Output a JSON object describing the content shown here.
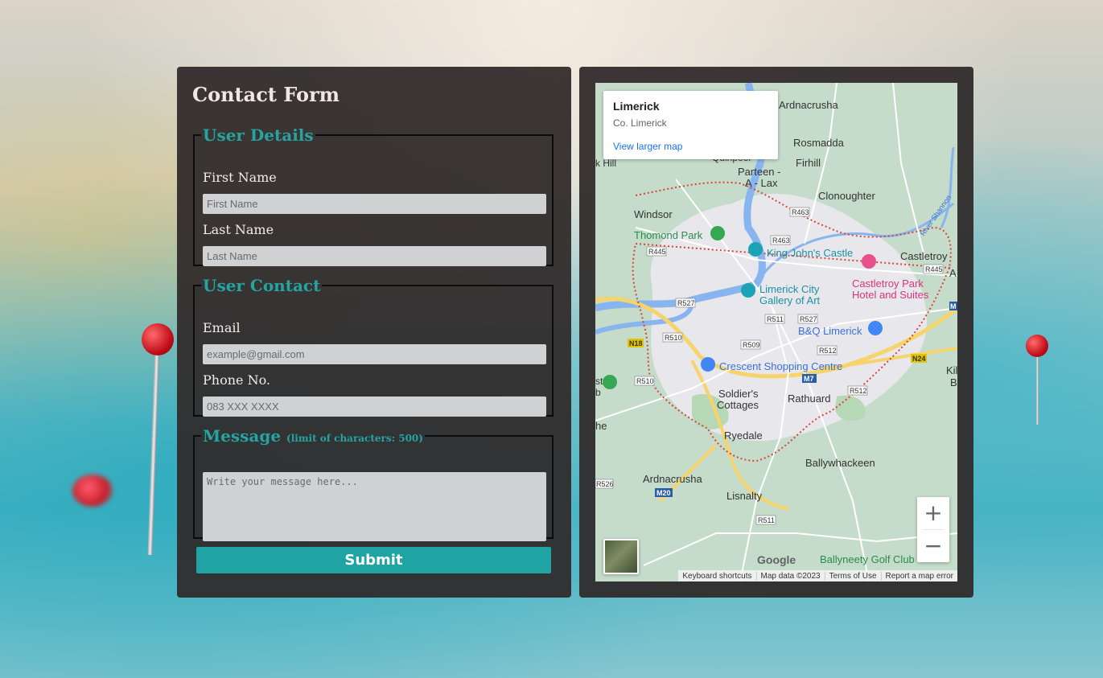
{
  "form": {
    "title": "Contact Form",
    "user_details": {
      "legend": "User Details",
      "first_name_label": "First Name",
      "first_name_placeholder": "First Name",
      "last_name_label": "Last Name",
      "last_name_placeholder": "Last Name"
    },
    "user_contact": {
      "legend": "User Contact",
      "email_label": "Email",
      "email_placeholder": "example@gmail.com",
      "phone_label": "Phone No.",
      "phone_placeholder": "083 XXX XXXX"
    },
    "message": {
      "legend": "Message",
      "hint": "(limit of characters: 500)",
      "placeholder": "Write your message here..."
    },
    "submit_label": "Submit"
  },
  "map": {
    "card": {
      "title": "Limerick",
      "subtitle": "Co. Limerick",
      "link": "View larger map"
    },
    "zoom_in": "+",
    "zoom_out": "−",
    "logo": "Google",
    "attribution": {
      "shortcuts": "Keyboard shortcuts",
      "data": "Map data ©2023",
      "terms": "Terms of Use",
      "report": "Report a map error"
    },
    "places": {
      "ardnacrusha_top": "Ardnacrusha",
      "rosmadda": "Rosmadda",
      "firhill": "Firhill",
      "quinpool": "Quinpool",
      "parteen": "Parteen -",
      "parteen2": "A - Lax",
      "k_hill": "k Hill",
      "clonoughter": "Clonoughter",
      "windsor": "Windsor",
      "thomond_park": "Thomond Park",
      "king_johns": "King John's Castle",
      "castletroy": "Castletroy",
      "castletroy_park": "Castletroy Park",
      "castletroy_park2": "Hotel and Suites",
      "limerick_gallery": "Limerick City",
      "limerick_gallery2": "Gallery of Art",
      "bq": "B&Q Limerick",
      "crescent": "Crescent Shopping Centre",
      "soldiers": "Soldier's",
      "soldiers2": "Cottages",
      "rathuard": "Rathuard",
      "ryedale": "Ryedale",
      "ballywhackeen": "Ballywhackeen",
      "ardnacrusha_bottom": "Ardnacrusha",
      "lisnalty": "Lisnalty",
      "ballyneety": "Ballyneety Golf Club",
      "river_shannon": "River Shannon",
      "kil": "Kil",
      "b": "B",
      "a": "A",
      "he": "he",
      "st": "st",
      "b2": "b"
    },
    "roads": {
      "r463a": "R463",
      "r463b": "R463",
      "r445a": "R445",
      "r445b": "R445",
      "r527a": "R527",
      "r527b": "R527",
      "r511a": "R511",
      "r511b": "R511",
      "r510a": "R510",
      "r510b": "R510",
      "r509": "R509",
      "r512a": "R512",
      "r512b": "R512",
      "r526": "R526",
      "n18": "N18",
      "n24": "N24",
      "m7": "M7",
      "m20": "M20",
      "m": "M"
    }
  },
  "colors": {
    "panel_bg": "#302a2a",
    "accent_teal": "#1fa4a3",
    "legend_teal": "#25a4a1",
    "input_bg": "#cfd1d2",
    "map_green": "#c4dcc9",
    "map_water": "#88b4f0",
    "road_yellow": "#f7d36b",
    "border_red_dotted": "#d9443a"
  }
}
